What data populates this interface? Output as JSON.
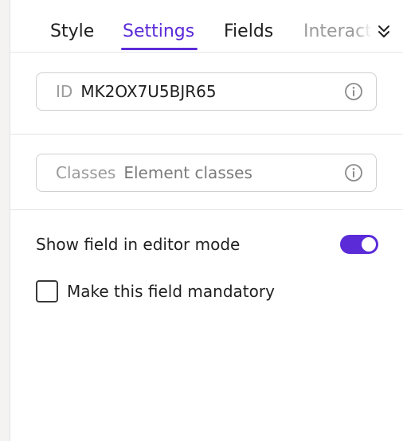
{
  "tabs": {
    "style": "Style",
    "settings": "Settings",
    "fields": "Fields",
    "interactions": "Interactions",
    "active": "Settings"
  },
  "id_field": {
    "label": "ID",
    "value": "MK2OX7U5BJR65"
  },
  "classes_field": {
    "label": "Classes",
    "placeholder": "Element classes"
  },
  "options": {
    "show_in_editor": {
      "label": "Show field in editor mode",
      "enabled": true
    },
    "mandatory": {
      "label": "Make this field mandatory",
      "checked": false
    }
  },
  "colors": {
    "accent": "#5b2bd8",
    "text": "#1f1f1f",
    "muted": "#9b9b9b",
    "border": "#cfcfcf"
  },
  "icons": {
    "info": "info-icon",
    "more_tabs": "chevron-double-down-icon"
  }
}
